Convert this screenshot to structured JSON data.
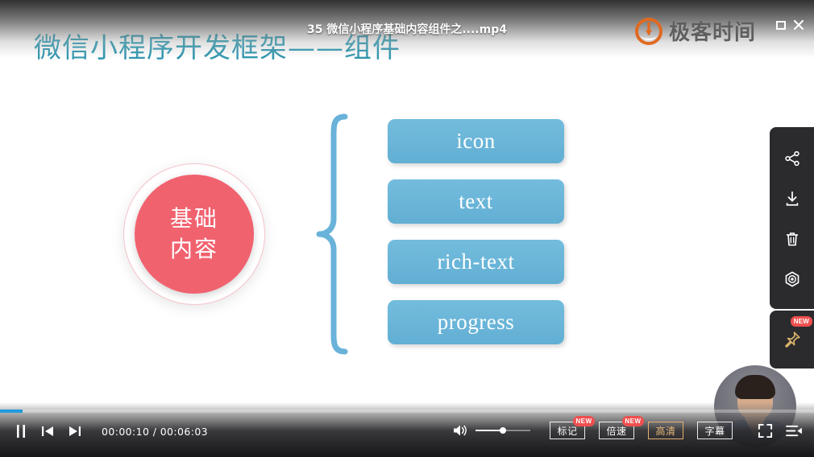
{
  "window": {
    "title": "35  微信小程序基础内容组件之....mp4",
    "brand_text": "极客时间",
    "brand_mark": "geektime-logo-icon",
    "maximize_label": "maximize-restore",
    "close_label": "close"
  },
  "slide": {
    "title": "微信小程序开发框架——组件",
    "center_node": {
      "line1": "基础",
      "line2": "内容",
      "color": "#f1626f"
    },
    "brace": "curly-brace",
    "items": [
      {
        "label": "icon"
      },
      {
        "label": "text"
      },
      {
        "label": "rich-text"
      },
      {
        "label": "progress"
      }
    ],
    "item_color": "#68b3d6"
  },
  "rail": {
    "buttons": [
      {
        "name": "share-icon",
        "label": "分享"
      },
      {
        "name": "download-icon",
        "label": "下载"
      },
      {
        "name": "delete-icon",
        "label": "删除"
      },
      {
        "name": "record-icon",
        "label": "录制"
      }
    ],
    "pin": {
      "name": "pin-icon",
      "label": "置顶",
      "badge": "NEW",
      "color": "#d6b26a"
    }
  },
  "player": {
    "state": "playing",
    "pause_label": "pause",
    "prev_label": "previous",
    "next_label": "next",
    "current_time": "00:00:10",
    "total_time": "00:06:03",
    "time_display": "00:00:10 / 00:06:03",
    "progress_percent": 2.8,
    "volume_percent": 50,
    "volume_label": "volume",
    "buttons": [
      {
        "name": "mark-button",
        "label": "标记",
        "badge": "NEW",
        "active": false
      },
      {
        "name": "speed-button",
        "label": "倍速",
        "badge": "NEW",
        "active": false
      },
      {
        "name": "quality-button",
        "label": "高清",
        "badge": "",
        "active": true
      },
      {
        "name": "subtitle-button",
        "label": "字幕",
        "badge": "",
        "active": false
      }
    ],
    "fullscreen_label": "fullscreen",
    "playlist_label": "playlist",
    "accent_color": "#1f9bde",
    "active_color": "#e9b879"
  },
  "pip": {
    "label": "presenter-camera"
  }
}
